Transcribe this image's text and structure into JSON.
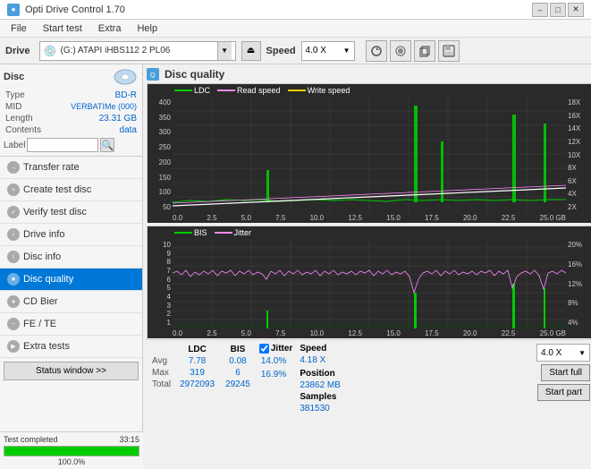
{
  "titlebar": {
    "title": "Opti Drive Control 1.70",
    "icon": "●",
    "min_btn": "–",
    "max_btn": "□",
    "close_btn": "✕"
  },
  "menubar": {
    "items": [
      "File",
      "Start test",
      "Extra",
      "Help"
    ]
  },
  "drivebar": {
    "label": "Drive",
    "drive_value": "(G:) ATAPI iHBS112  2 PL06",
    "speed_label": "Speed",
    "speed_value": "4.0 X"
  },
  "disc": {
    "label": "Disc",
    "type_key": "Type",
    "type_val": "BD-R",
    "mid_key": "MID",
    "mid_val": "VERBATIMe (000)",
    "length_key": "Length",
    "length_val": "23.31 GB",
    "contents_key": "Contents",
    "contents_val": "data",
    "label_key": "Label",
    "label_val": ""
  },
  "nav": {
    "items": [
      {
        "id": "transfer-rate",
        "label": "Transfer rate"
      },
      {
        "id": "create-test-disc",
        "label": "Create test disc"
      },
      {
        "id": "verify-test-disc",
        "label": "Verify test disc"
      },
      {
        "id": "drive-info",
        "label": "Drive info"
      },
      {
        "id": "disc-info",
        "label": "Disc info"
      },
      {
        "id": "disc-quality",
        "label": "Disc quality",
        "active": true
      },
      {
        "id": "cd-bier",
        "label": "CD Bier"
      },
      {
        "id": "fe-te",
        "label": "FE / TE"
      },
      {
        "id": "extra-tests",
        "label": "Extra tests"
      }
    ]
  },
  "status_window_btn": "Status window >>",
  "progress": {
    "percent": 100,
    "label": "100.0%",
    "time": "33:15"
  },
  "chart": {
    "title": "Disc quality",
    "legend": {
      "ldc": "LDC",
      "read": "Read speed",
      "write": "Write speed"
    },
    "legend2": {
      "bis": "BIS",
      "jitter": "Jitter"
    },
    "y_max1": 400,
    "y_axis1": [
      "400",
      "350",
      "300",
      "250",
      "200",
      "150",
      "100",
      "50"
    ],
    "y_axis1_right": [
      "18X",
      "16X",
      "14X",
      "12X",
      "10X",
      "8X",
      "6X",
      "4X",
      "2X"
    ],
    "x_axis": [
      "0.0",
      "2.5",
      "5.0",
      "7.5",
      "10.0",
      "12.5",
      "15.0",
      "17.5",
      "20.0",
      "22.5",
      "25.0 GB"
    ],
    "y_axis2": [
      "10",
      "9",
      "8",
      "7",
      "6",
      "5",
      "4",
      "3",
      "2",
      "1"
    ],
    "y_axis2_right": [
      "20%",
      "16%",
      "12%",
      "8%",
      "4%"
    ]
  },
  "stats": {
    "headers": [
      "LDC",
      "BIS",
      "",
      "Jitter",
      "Speed",
      ""
    ],
    "avg_label": "Avg",
    "avg_ldc": "7.78",
    "avg_bis": "0.08",
    "avg_jitter": "14.0%",
    "avg_speed": "4.18 X",
    "avg_speed_right": "4.0 X",
    "max_label": "Max",
    "max_ldc": "319",
    "max_bis": "6",
    "max_jitter": "16.9%",
    "pos_label": "Position",
    "pos_val": "23862 MB",
    "total_label": "Total",
    "total_ldc": "2972093",
    "total_bis": "29245",
    "samples_label": "Samples",
    "samples_val": "381530",
    "start_full_btn": "Start full",
    "start_part_btn": "Start part",
    "jitter_checked": true
  }
}
